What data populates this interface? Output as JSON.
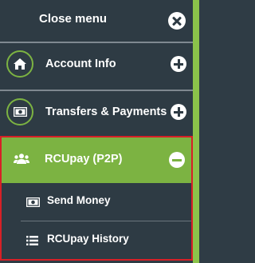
{
  "menu": {
    "close_label": "Close menu",
    "items": [
      {
        "label": "Account Info",
        "icon": "home-icon"
      },
      {
        "label": "Transfers & Payments",
        "icon": "money-icon"
      }
    ],
    "expanded": {
      "label": "RCUpay (P2P)",
      "icon": "users-icon",
      "subitems": [
        {
          "label": "Send Money",
          "icon": "money-icon"
        },
        {
          "label": "RCUpay History",
          "icon": "list-icon"
        }
      ]
    }
  },
  "colors": {
    "panel": "#2e3b44",
    "accent": "#7cb342",
    "highlight_border": "#d62027"
  }
}
